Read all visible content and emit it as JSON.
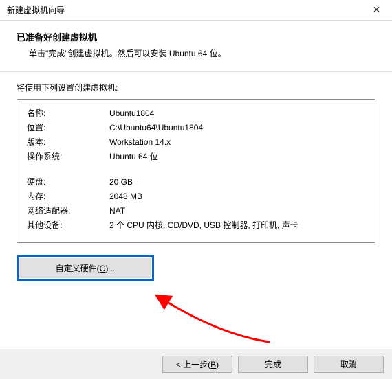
{
  "window": {
    "title": "新建虚拟机向导"
  },
  "header": {
    "title": "已准备好创建虚拟机",
    "subtitle": "单击\"完成\"创建虚拟机。然后可以安装 Ubuntu 64 位。"
  },
  "content": {
    "label": "将使用下列设置创建虚拟机:"
  },
  "summary": {
    "group1": [
      {
        "label": "名称:",
        "value": "Ubuntu1804"
      },
      {
        "label": "位置:",
        "value": "C:\\Ubuntu64\\Ubuntu1804"
      },
      {
        "label": "版本:",
        "value": "Workstation 14.x"
      },
      {
        "label": "操作系统:",
        "value": "Ubuntu 64 位"
      }
    ],
    "group2": [
      {
        "label": "硬盘:",
        "value": "20 GB"
      },
      {
        "label": "内存:",
        "value": "2048 MB"
      },
      {
        "label": "网络适配器:",
        "value": "NAT"
      },
      {
        "label": "其他设备:",
        "value": "2 个 CPU 内核, CD/DVD, USB 控制器, 打印机, 声卡"
      }
    ]
  },
  "buttons": {
    "customize_prefix": "自定义硬件(",
    "customize_key": "C",
    "customize_suffix": ")...",
    "back_prefix": "< 上一步(",
    "back_key": "B",
    "back_suffix": ")",
    "finish": "完成",
    "cancel": "取消"
  },
  "annotation": {
    "arrow_color": "#ff0000"
  }
}
